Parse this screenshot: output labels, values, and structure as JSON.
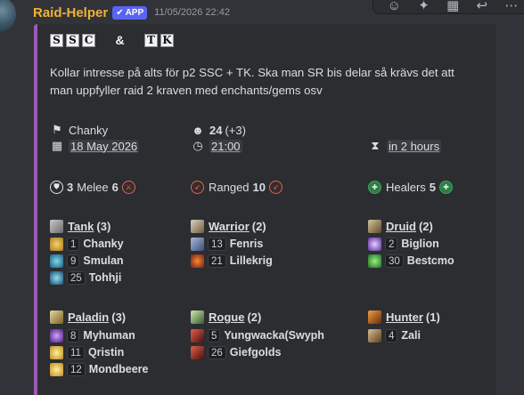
{
  "message": {
    "author": "Raid-Helper",
    "badge": "APP",
    "timestamp": "11/05/2026 22:42"
  },
  "toolbar_icons": [
    "add-reaction-icon",
    "super-reaction-icon",
    "apps-icon",
    "reply-icon",
    "more-icon"
  ],
  "embed": {
    "accent_color": "#9b59b6",
    "title_chars": [
      "S",
      "S",
      "C",
      "&",
      "T",
      "K"
    ],
    "description": "Kollar intresse på alts för p2 SSC + TK. Ska man SR bis delar så krävs det att man uppfyller raid 2 kraven med enchants/gems osv",
    "leader": "Chanky",
    "date": "18 May 2026",
    "signups_count": "24",
    "signups_extra": "(+3)",
    "time": "21:00",
    "countdown": "in 2 hours",
    "roles": {
      "melee_count": "3",
      "melee_label": "Melee",
      "melee_count2": "6",
      "ranged_label": "Ranged",
      "ranged_count": "10",
      "healers_label": "Healers",
      "healers_count": "5"
    },
    "classes": [
      {
        "name": "Tank",
        "count": "(3)",
        "players": [
          {
            "num": "1",
            "name": "Chanky"
          },
          {
            "num": "9",
            "name": "Smulan"
          },
          {
            "num": "25",
            "name": "Tohhji"
          }
        ]
      },
      {
        "name": "Warrior",
        "count": "(2)",
        "players": [
          {
            "num": "13",
            "name": "Fenris"
          },
          {
            "num": "21",
            "name": "Lillekrig"
          }
        ]
      },
      {
        "name": "Druid",
        "count": "(2)",
        "players": [
          {
            "num": "2",
            "name": "Biglion"
          },
          {
            "num": "30",
            "name": "Bestcmo"
          }
        ]
      },
      {
        "name": "Paladin",
        "count": "(3)",
        "players": [
          {
            "num": "8",
            "name": "Myhuman"
          },
          {
            "num": "11",
            "name": "Qristin"
          },
          {
            "num": "12",
            "name": "Mondbeere"
          }
        ]
      },
      {
        "name": "Rogue",
        "count": "(2)",
        "players": [
          {
            "num": "5",
            "name": "Yungwacka(Swyph"
          },
          {
            "num": "26",
            "name": "Giefgolds"
          }
        ]
      },
      {
        "name": "Hunter",
        "count": "(1)",
        "players": [
          {
            "num": "4",
            "name": "Zali"
          }
        ]
      }
    ]
  }
}
